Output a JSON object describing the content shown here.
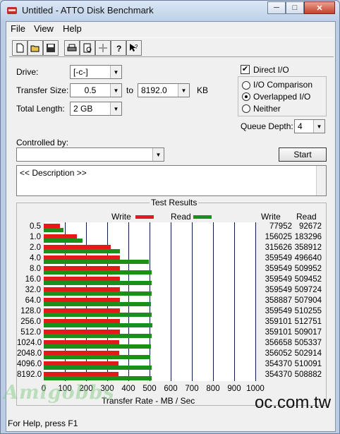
{
  "window": {
    "title": "Untitled - ATTO Disk Benchmark",
    "min_glyph": "─",
    "max_glyph": "□",
    "close_glyph": "✕"
  },
  "menu": {
    "file": "File",
    "view": "View",
    "help": "Help"
  },
  "toolbar": {
    "buttons": [
      "new-icon",
      "open-icon",
      "save-icon",
      "print-icon",
      "print-preview-icon",
      "move-icon",
      "help-icon",
      "context-help-icon"
    ]
  },
  "form": {
    "drive_label": "Drive:",
    "drive_value": "[-c-]",
    "transfer_size_label": "Transfer Size:",
    "transfer_from": "0.5",
    "to_label": "to",
    "transfer_to": "8192.0",
    "kb_label": "KB",
    "total_length_label": "Total Length:",
    "total_length_value": "2 GB",
    "controlled_by_label": "Controlled by:",
    "controlled_by_value": "",
    "direct_io_label": "Direct I/O",
    "direct_io_checked": "✔",
    "io_comparison_label": "I/O Comparison",
    "overlapped_io_label": "Overlapped I/O",
    "neither_label": "Neither",
    "queue_depth_label": "Queue Depth:",
    "queue_depth_value": "4",
    "start_label": "Start",
    "description": "<< Description >>"
  },
  "results": {
    "title": "Test Results",
    "legend_write": "Write",
    "legend_read": "Read",
    "col_write": "Write",
    "col_read": "Read",
    "axis_label": "Transfer Rate - MB / Sec"
  },
  "chart_data": {
    "type": "bar",
    "title": "Test Results",
    "xlabel": "Transfer Rate - MB / Sec",
    "xlim": [
      0,
      1000
    ],
    "xticks": [
      "0",
      "100",
      "200",
      "300",
      "400",
      "500",
      "600",
      "700",
      "800",
      "900",
      "1000"
    ],
    "categories": [
      "0.5",
      "1.0",
      "2.0",
      "4.0",
      "8.0",
      "16.0",
      "32.0",
      "64.0",
      "128.0",
      "256.0",
      "512.0",
      "1024.0",
      "2048.0",
      "4096.0",
      "8192.0"
    ],
    "series": [
      {
        "name": "Write",
        "color": "#e41a1a",
        "values": [
          77952,
          156025,
          315626,
          359549,
          359549,
          359549,
          359549,
          358887,
          359549,
          359101,
          359101,
          356658,
          356052,
          354370,
          354370
        ]
      },
      {
        "name": "Read",
        "color": "#1a8f1a",
        "values": [
          92672,
          183296,
          358912,
          496640,
          509952,
          509452,
          509724,
          507904,
          510255,
          512751,
          509017,
          505337,
          502914,
          510091,
          508882
        ]
      }
    ]
  },
  "status": {
    "text": "For Help, press F1"
  },
  "watermarks": {
    "left": "Amigobbs",
    "right": "oc.com.tw"
  }
}
